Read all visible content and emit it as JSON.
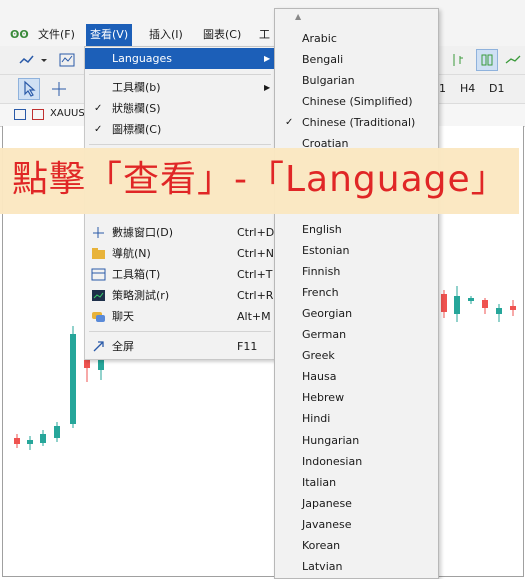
{
  "menubar": {
    "items": [
      {
        "label": "文件(F)"
      },
      {
        "label": "查看(V)"
      },
      {
        "label": "插入(I)"
      },
      {
        "label": "圖表(C)"
      },
      {
        "label": "工"
      }
    ]
  },
  "toolbar2": {
    "timeframes": [
      "1",
      "H4",
      "D1"
    ]
  },
  "chart_tab": {
    "symbol": "XAUUS"
  },
  "view_menu": {
    "items": [
      {
        "label": "Languages",
        "has_submenu": true,
        "highlighted": true
      },
      {
        "label": "工具欄(b)",
        "has_submenu": true
      },
      {
        "label": "狀態欄(S)",
        "checked": true
      },
      {
        "label": "圖標欄(C)",
        "checked": true
      },
      {
        "label": "數據窗口(D)",
        "shortcut": "Ctrl+D",
        "icon": "data-window-icon"
      },
      {
        "label": "導航(N)",
        "shortcut": "Ctrl+N",
        "icon": "navigator-icon"
      },
      {
        "label": "工具箱(T)",
        "shortcut": "Ctrl+T",
        "icon": "toolbox-icon"
      },
      {
        "label": "策略測試(r)",
        "shortcut": "Ctrl+R",
        "icon": "strategy-tester-icon"
      },
      {
        "label": "聊天",
        "shortcut": "Alt+M",
        "icon": "chat-icon"
      },
      {
        "label": "全屏",
        "shortcut": "F11",
        "icon": "fullscreen-icon"
      }
    ]
  },
  "language_menu": {
    "items": [
      {
        "label": "Arabic"
      },
      {
        "label": "Bengali"
      },
      {
        "label": "Bulgarian"
      },
      {
        "label": "Chinese (Simplified)"
      },
      {
        "label": "Chinese (Traditional)",
        "checked": true
      },
      {
        "label": "Croatian"
      },
      {
        "label": "English"
      },
      {
        "label": "Estonian"
      },
      {
        "label": "Finnish"
      },
      {
        "label": "French"
      },
      {
        "label": "Georgian"
      },
      {
        "label": "German"
      },
      {
        "label": "Greek"
      },
      {
        "label": "Hausa"
      },
      {
        "label": "Hebrew"
      },
      {
        "label": "Hindi"
      },
      {
        "label": "Hungarian"
      },
      {
        "label": "Indonesian"
      },
      {
        "label": "Italian"
      },
      {
        "label": "Japanese"
      },
      {
        "label": "Javanese"
      },
      {
        "label": "Korean"
      },
      {
        "label": "Latvian"
      }
    ]
  },
  "annotation": {
    "text": "點擊「查看」-「Language」"
  },
  "colors": {
    "highlight": "#1c5fb8",
    "banner_bg": "#fbe8c2",
    "banner_text": "#e02020",
    "bull": "#26a69a",
    "bear": "#ef5350"
  }
}
